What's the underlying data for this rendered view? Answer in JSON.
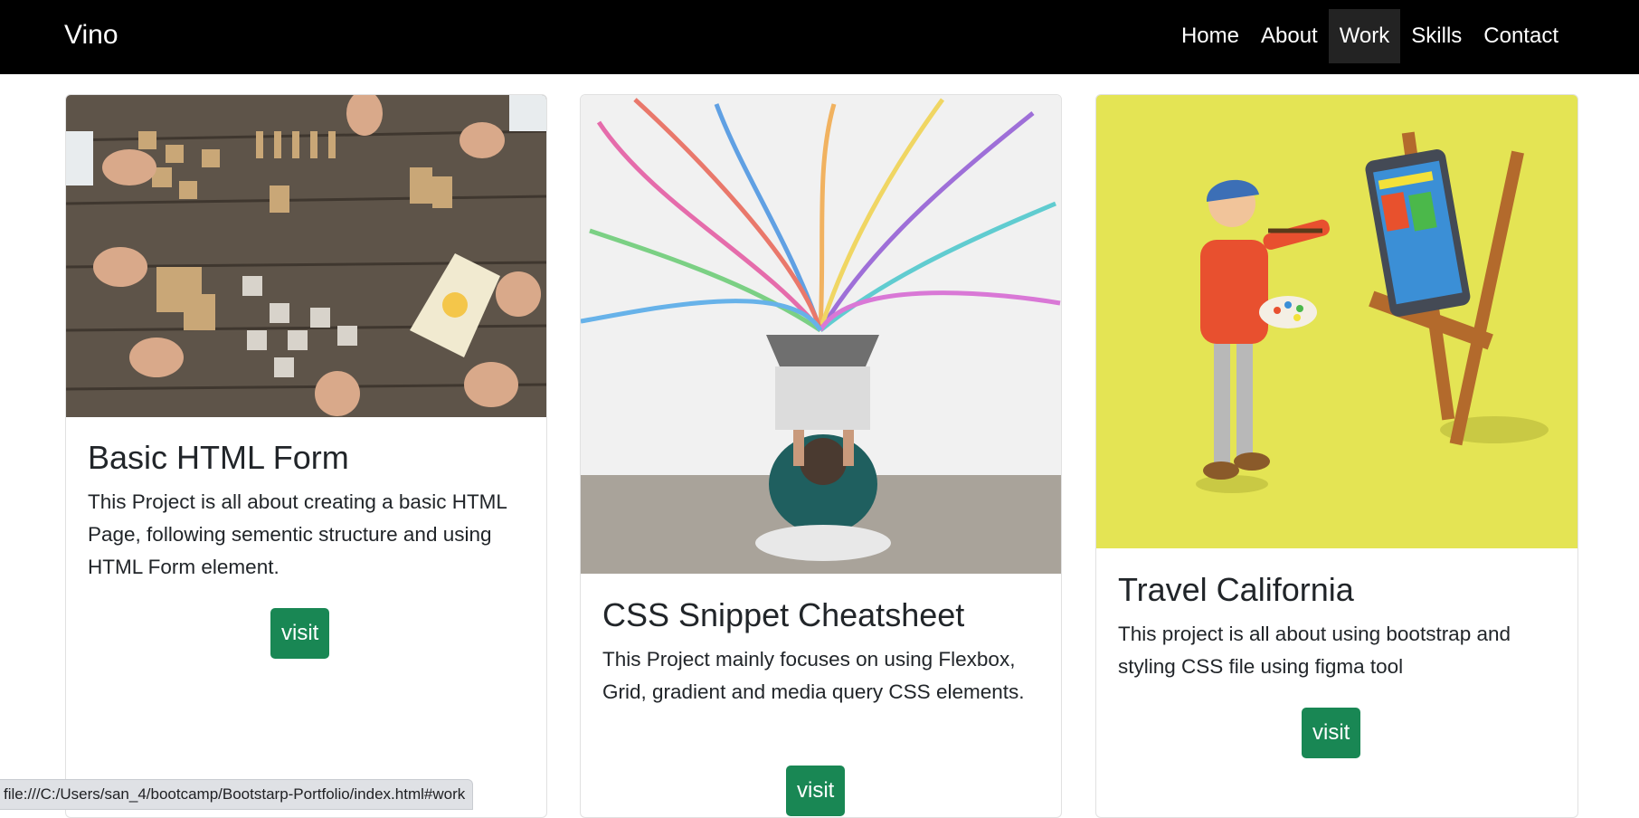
{
  "navbar": {
    "brand": "Vino",
    "links": [
      "Home",
      "About",
      "Work",
      "Skills",
      "Contact"
    ],
    "active": "Work"
  },
  "cards": [
    {
      "title": "Basic HTML Form",
      "text": "This Project is all about creating a basic HTML Page, following sementic structure and using HTML Form element.",
      "button": "visit"
    },
    {
      "title": "CSS Snippet Cheatsheet",
      "text": "This Project mainly focuses on using Flexbox, Grid, gradient and media query CSS elements.",
      "button": "visit"
    },
    {
      "title": "Travel California",
      "text": "This project is all about using bootstrap and styling CSS file using figma tool",
      "button": "visit"
    }
  ],
  "status_bar": {
    "url": "file:///C:/Users/san_4/bootcamp/Bootstarp-Portfolio/index.html#work"
  },
  "colors": {
    "navbar_bg": "#000000",
    "button_bg": "#198754",
    "card3_image_bg": "#e4e454"
  }
}
